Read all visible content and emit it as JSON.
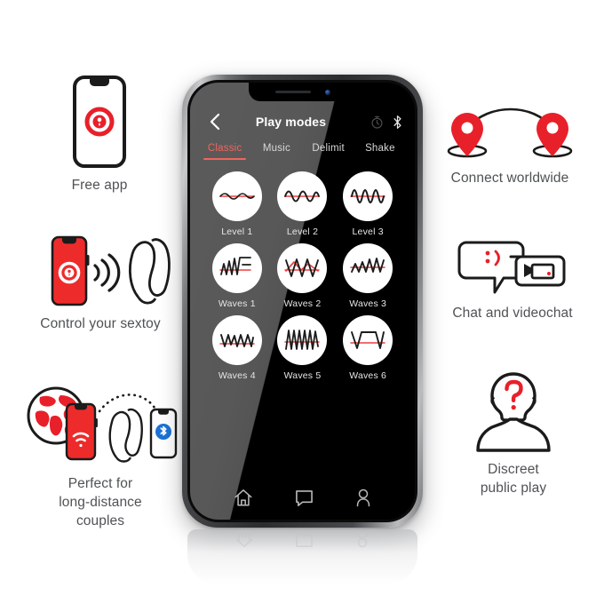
{
  "page": {
    "background": "#ffffff",
    "accent_red": "#e8202a",
    "accent_salmon": "#f2645c",
    "caption_color": "#4f5254"
  },
  "features_left": [
    {
      "id": "free-app",
      "icon": "phone-with-app-logo-icon",
      "caption": "Free app"
    },
    {
      "id": "control",
      "icon": "phone-signal-toy-icon",
      "caption": "Control your sextoy"
    },
    {
      "id": "longdistance",
      "icon": "globe-phone-toy-bluetooth-icon",
      "caption": "Perfect for\nlong-distance\ncouples"
    }
  ],
  "features_right": [
    {
      "id": "worldwide",
      "icon": "two-map-pins-arc-icon",
      "caption": "Connect worldwide"
    },
    {
      "id": "chat",
      "icon": "speech-bubbles-video-icon",
      "caption": "Chat and videochat"
    },
    {
      "id": "discreet",
      "icon": "person-question-mark-icon",
      "caption": "Discreet\npublic play"
    }
  ],
  "phone": {
    "status": {
      "speaker": "earpiece-speaker",
      "camera": "front-camera-dot"
    },
    "appbar": {
      "back_icon": "chevron-left-icon",
      "title": "Play modes",
      "icons": [
        {
          "name": "timer-icon",
          "label": "Timer"
        },
        {
          "name": "bluetooth-icon",
          "label": "Bluetooth"
        }
      ]
    },
    "tabs": [
      {
        "label": "Classic",
        "active": true
      },
      {
        "label": "Music",
        "active": false
      },
      {
        "label": "Delimit",
        "active": false
      },
      {
        "label": "Shake",
        "active": false
      }
    ],
    "modes": [
      {
        "label": "Level 1",
        "wave": "sine-low"
      },
      {
        "label": "Level 2",
        "wave": "sine-mid"
      },
      {
        "label": "Level 3",
        "wave": "sine-high"
      },
      {
        "label": "Waves 1",
        "wave": "ramp-up-flat"
      },
      {
        "label": "Waves 2",
        "wave": "zigzag-wide"
      },
      {
        "label": "Waves 3",
        "wave": "zigzag-rising"
      },
      {
        "label": "Waves 4",
        "wave": "zigzag-dense"
      },
      {
        "label": "Waves 5",
        "wave": "sawtooth-tall"
      },
      {
        "label": "Waves 6",
        "wave": "square-plateau"
      }
    ],
    "bottom_nav": [
      {
        "name": "home-icon",
        "label": "Home"
      },
      {
        "name": "chat-icon",
        "label": "Chat"
      },
      {
        "name": "profile-icon",
        "label": "Profile"
      }
    ]
  }
}
